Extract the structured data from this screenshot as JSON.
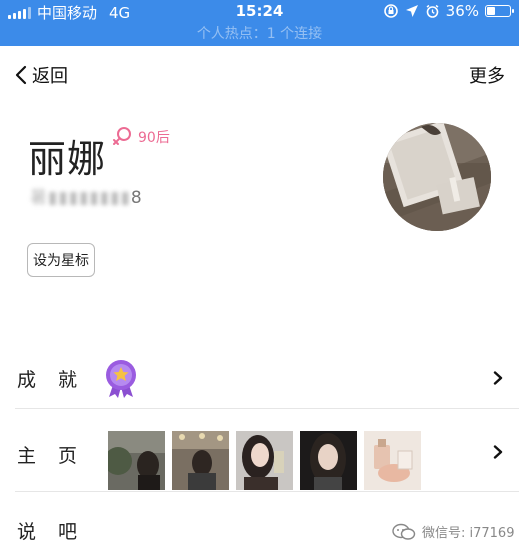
{
  "status_bar": {
    "carrier": "中国移动",
    "network": "4G",
    "time": "15:24",
    "battery": "36%",
    "battery_level": 0.36
  },
  "banner": {
    "text": "个人热点：1 个连接"
  },
  "nav": {
    "back_label": "返回",
    "more_label": "更多"
  },
  "profile": {
    "name": "丽娜",
    "age_tag": "90后",
    "account_masked": "暑▮▮▮▮▮▮▮▮",
    "account_last_digit": "8",
    "star_button_label": "设为星标"
  },
  "rows": {
    "achievement_label": "成就",
    "homepage_label": "主页",
    "talk_label": "说吧"
  },
  "watermark": {
    "text": "微信号: i77169"
  },
  "colors": {
    "brand_blue": "#3c8be9",
    "age_pink": "#ec6b93",
    "medal_purple": "#8b4fd1"
  }
}
